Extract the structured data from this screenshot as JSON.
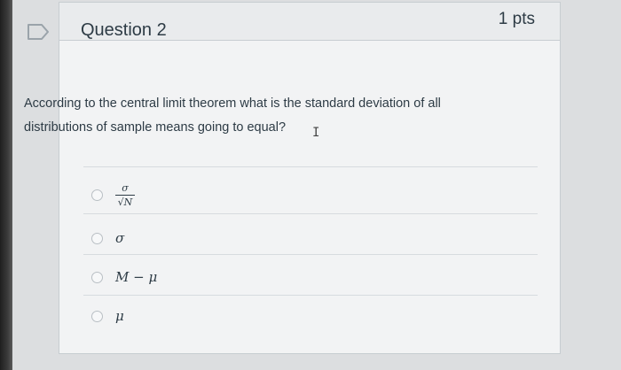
{
  "question": {
    "title": "Question 2",
    "points": "1 pts",
    "text": "According to the central limit theorem what is the standard deviation of all distributions of sample means going to equal?"
  },
  "answers": [
    {
      "numerator": "σ",
      "denominator": "√N"
    },
    {
      "label": "σ"
    },
    {
      "label": "M − μ"
    },
    {
      "label": "μ"
    }
  ],
  "icons": {
    "flag": "bookmark-flag-icon"
  },
  "colors": {
    "text": "#2d3b45",
    "border": "#c7cdd1",
    "header_bg": "#e9ebed"
  }
}
